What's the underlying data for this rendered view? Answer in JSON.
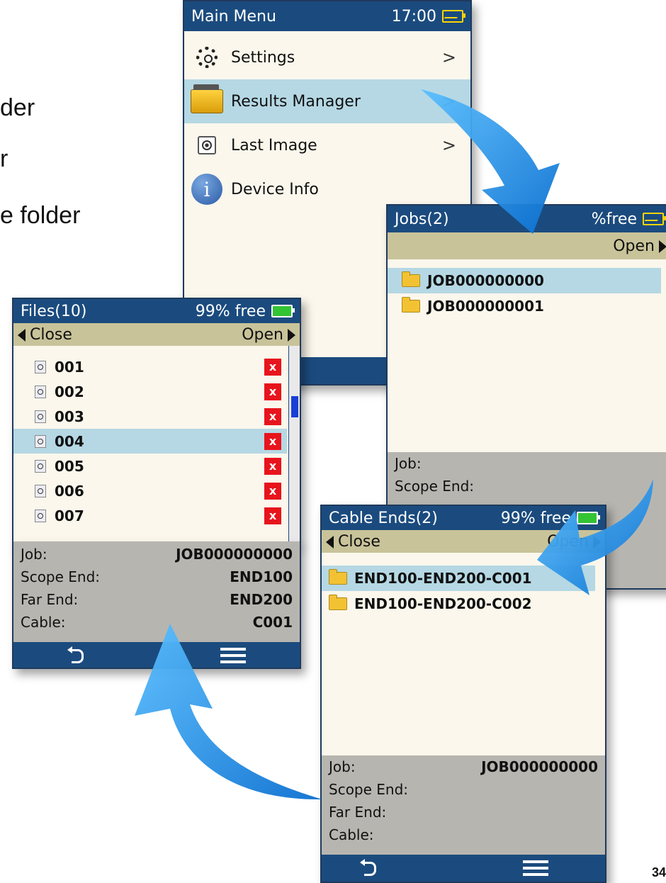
{
  "background_text": {
    "line1": "der",
    "line2": "r",
    "line3": "e folder",
    "page_number": "34"
  },
  "main_menu": {
    "title": "Main Menu",
    "time": "17:00",
    "items": [
      {
        "label": "Settings",
        "chevron": ">",
        "icon": "gear-icon"
      },
      {
        "label": "Results Manager",
        "chevron": ">",
        "icon": "folders-icon"
      },
      {
        "label": "Last Image",
        "chevron": ">",
        "icon": "image-target-icon"
      },
      {
        "label": "Device Info",
        "icon": "info-icon"
      }
    ]
  },
  "jobs": {
    "title": "Jobs(2)",
    "free": "%free",
    "open_label": "Open",
    "items": [
      "JOB000000000",
      "JOB000000001"
    ],
    "info": {
      "job_label": "Job:",
      "scope_end_label": "Scope End:"
    }
  },
  "cable_ends": {
    "title": "Cable Ends(2)",
    "free": "99% free",
    "close_label": "Close",
    "open_label": "Open",
    "items": [
      "END100-END200-C001",
      "END100-END200-C002"
    ],
    "info": {
      "job_label": "Job:",
      "job_value": "JOB000000000",
      "scope_end_label": "Scope End:",
      "far_end_label": "Far End:",
      "cable_label": "Cable:"
    }
  },
  "files": {
    "title": "Files(10)",
    "free": "99% free",
    "close_label": "Close",
    "open_label": "Open",
    "items": [
      "001",
      "002",
      "003",
      "004",
      "005",
      "006",
      "007"
    ],
    "delete_glyph": "x",
    "scroll_position": 0.2,
    "info": {
      "job_label": "Job:",
      "job_value": "JOB000000000",
      "scope_end_label": "Scope End:",
      "scope_end_value": "END100",
      "far_end_label": "Far End:",
      "far_end_value": "END200",
      "cable_label": "Cable:",
      "cable_value": "C001"
    }
  },
  "colors": {
    "title_bar": "#1b4b7e",
    "command_bar": "#c9c39a",
    "selection": "#b5d8e4",
    "list_bg": "#fbf7ec",
    "info_bg": "#b7b5b0",
    "arrow": "#1d8fe0",
    "delete": "#e8141c"
  }
}
